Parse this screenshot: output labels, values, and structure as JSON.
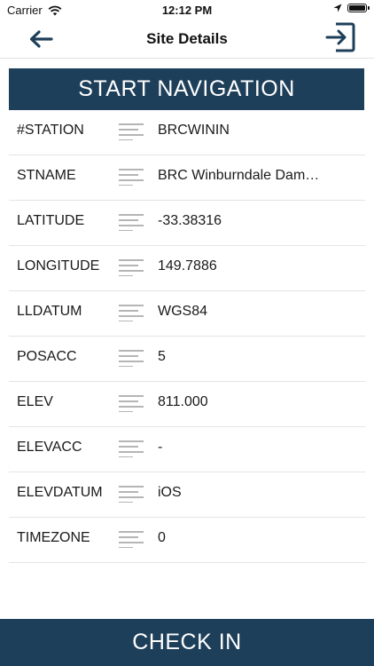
{
  "status_bar": {
    "carrier": "Carrier",
    "time": "12:12 PM",
    "icons": [
      "wifi-icon",
      "location-arrow-icon",
      "battery-icon"
    ]
  },
  "nav": {
    "title": "Site Details",
    "back_icon": "arrow-left-icon",
    "exit_icon": "exit-to-right-icon"
  },
  "start_navigation_label": "START NAVIGATION",
  "details": [
    {
      "label": "#STATION",
      "value": "BRCWININ"
    },
    {
      "label": "STNAME",
      "value": "BRC Winburndale Dam…"
    },
    {
      "label": "LATITUDE",
      "value": "-33.38316"
    },
    {
      "label": "LONGITUDE",
      "value": "149.7886"
    },
    {
      "label": "LLDATUM",
      "value": "WGS84"
    },
    {
      "label": "POSACC",
      "value": "5"
    },
    {
      "label": "ELEV",
      "value": "811.000"
    },
    {
      "label": "ELEVACC",
      "value": "-"
    },
    {
      "label": "ELEVDATUM",
      "value": "iOS"
    },
    {
      "label": "TIMEZONE",
      "value": "0"
    }
  ],
  "row_icon": "text-lines-icon",
  "check_in_label": "CHECK IN",
  "colors": {
    "primary": "#1e3f5a",
    "divider": "#e4e4e4",
    "icon_gray": "#b5b5b5"
  }
}
